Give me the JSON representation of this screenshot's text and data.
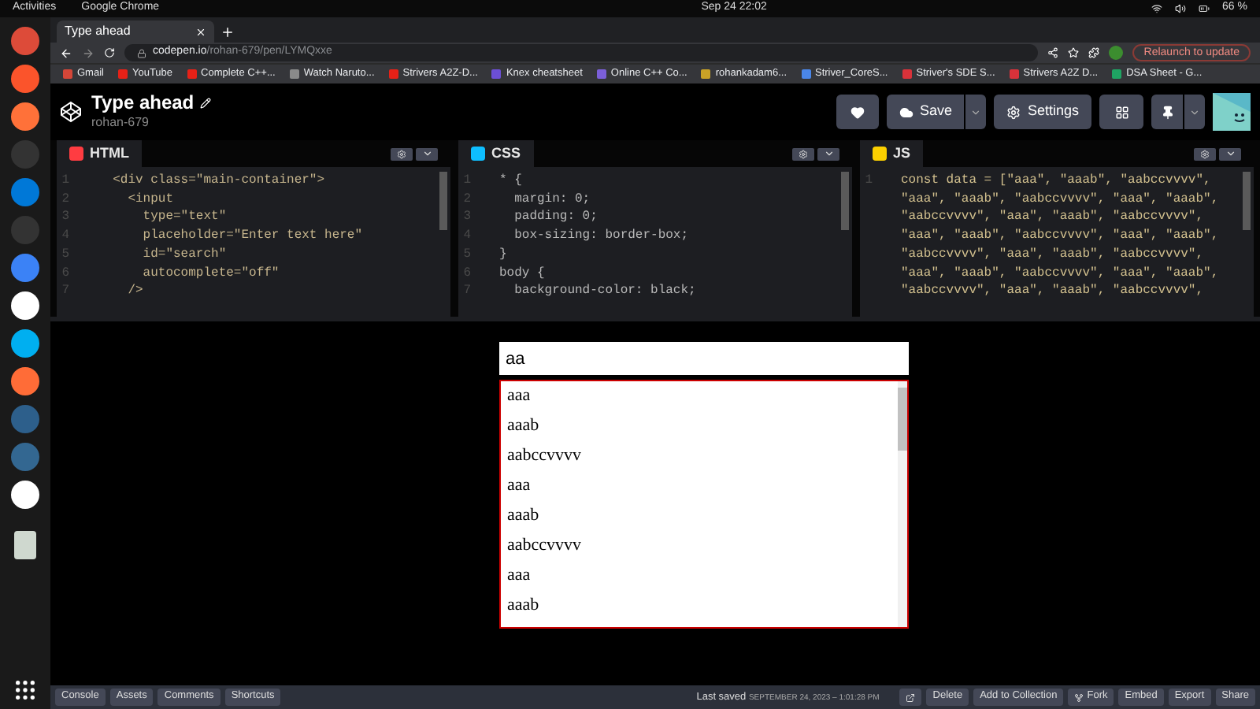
{
  "system_bar": {
    "activities": "Activities",
    "app": "Google Chrome",
    "clock": "Sep 24  22:02",
    "battery": "66 %"
  },
  "browser": {
    "tab_title": "Type ahead",
    "url_host": "codepen.io",
    "url_path": "/rohan-679/pen/LYMQxxe",
    "update_button": "Relaunch to update",
    "bookmarks": [
      {
        "label": "Gmail",
        "color": "#d44638"
      },
      {
        "label": "YouTube",
        "color": "#e62117"
      },
      {
        "label": "Complete C++...",
        "color": "#e62117"
      },
      {
        "label": "Watch Naruto...",
        "color": "#8a8a8a"
      },
      {
        "label": "Strivers A2Z-D...",
        "color": "#e62117"
      },
      {
        "label": "Knex cheatsheet",
        "color": "#6c4fd6"
      },
      {
        "label": "Online C++ Co...",
        "color": "#7b5fd9"
      },
      {
        "label": "rohankadam6...",
        "color": "#c9a227"
      },
      {
        "label": "Striver_CoreS...",
        "color": "#4a86e8"
      },
      {
        "label": "Striver's SDE S...",
        "color": "#d9323a"
      },
      {
        "label": "Strivers A2Z D...",
        "color": "#d9323a"
      },
      {
        "label": "DSA Sheet - G...",
        "color": "#1fa463"
      }
    ]
  },
  "pen": {
    "title": "Type ahead",
    "author": "rohan-679",
    "save": "Save",
    "settings": "Settings"
  },
  "editors": [
    {
      "kind": "html",
      "label": "HTML",
      "lines": [
        {
          "number": "1",
          "text": "  <div class=\"main-container\">"
        },
        {
          "number": "2",
          "text": "    <input"
        },
        {
          "number": "3",
          "text": "      type=\"text\""
        },
        {
          "number": "4",
          "text": "      placeholder=\"Enter text here\""
        },
        {
          "number": "5",
          "text": "      id=\"search\""
        },
        {
          "number": "6",
          "text": "      autocomplete=\"off\""
        },
        {
          "number": "7",
          "text": "    />"
        }
      ]
    },
    {
      "kind": "css",
      "label": "CSS",
      "lines": [
        {
          "number": "1",
          "text": "* {"
        },
        {
          "number": "2",
          "text": "  margin: 0;"
        },
        {
          "number": "3",
          "text": "  padding: 0;"
        },
        {
          "number": "4",
          "text": "  box-sizing: border-box;"
        },
        {
          "number": "5",
          "text": "}"
        },
        {
          "number": "6",
          "text": "body {"
        },
        {
          "number": "7",
          "text": "  background-color: black;"
        }
      ]
    },
    {
      "kind": "js",
      "label": "JS",
      "lines": [
        {
          "number": "1",
          "text": "const data = [\"aaa\", \"aaab\", \"aabccvvvv\","
        },
        {
          "text": "\"aaa\", \"aaab\", \"aabccvvvv\", \"aaa\", \"aaab\","
        },
        {
          "text": "\"aabccvvvv\", \"aaa\", \"aaab\", \"aabccvvvv\","
        },
        {
          "text": "\"aaa\", \"aaab\", \"aabccvvvv\", \"aaa\", \"aaab\","
        },
        {
          "text": "\"aabccvvvv\", \"aaa\", \"aaab\", \"aabccvvvv\","
        },
        {
          "text": "\"aaa\", \"aaab\", \"aabccvvvv\", \"aaa\", \"aaab\","
        },
        {
          "text": "\"aabccvvvv\", \"aaa\", \"aaab\", \"aabccvvvv\","
        }
      ]
    }
  ],
  "preview": {
    "input_value": "aa",
    "results": [
      "aaa",
      "aaab",
      "aabccvvvv",
      "aaa",
      "aaab",
      "aabccvvvv",
      "aaa",
      "aaab"
    ]
  },
  "footer": {
    "tabs": [
      "Console",
      "Assets",
      "Comments",
      "Shortcuts"
    ],
    "last_saved_label": "Last saved",
    "last_saved_time": "SEPTEMBER 24, 2023 – 1:01:28 PM",
    "actions": [
      {
        "kind": "plain",
        "label": "Delete"
      },
      {
        "kind": "plain",
        "label": "Add to Collection"
      },
      {
        "kind": "fork",
        "label": "Fork"
      },
      {
        "kind": "plain",
        "label": "Embed"
      },
      {
        "kind": "plain",
        "label": "Export"
      },
      {
        "kind": "plain",
        "label": "Share"
      }
    ]
  }
}
